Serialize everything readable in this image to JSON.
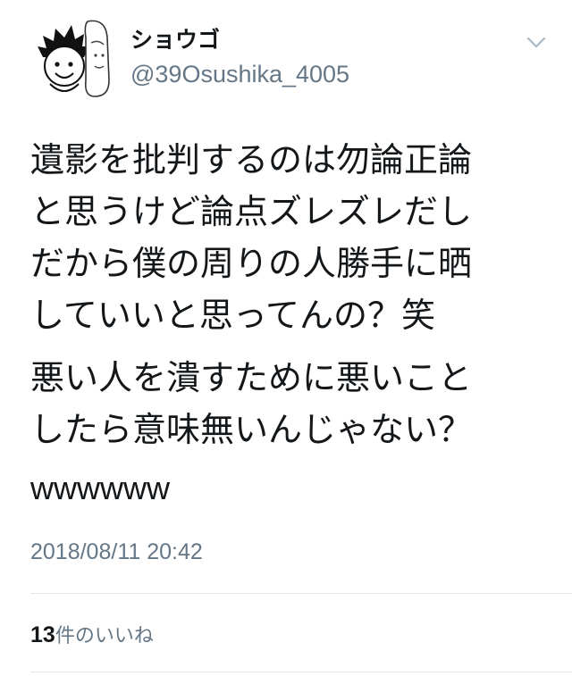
{
  "user": {
    "display_name": "ショウゴ",
    "handle": "@39Osushika_4005",
    "avatar_icon": "cartoon-avatar-icon"
  },
  "menu": {
    "icon": "chevron-down-icon"
  },
  "tweet": {
    "paragraph1": [
      "遺影を批判するのは勿論正論",
      "と思うけど論点ズレズレだし",
      "だから僕の周りの人勝手に晒",
      "していいと思ってんの？笑"
    ],
    "paragraph2": [
      "悪い人を潰すために悪いこと",
      "したら意味無いんじゃない？"
    ],
    "laugh": "wwwwww",
    "timestamp": "2018/08/11 20:42"
  },
  "likes": {
    "count": "13",
    "label": "件のいいね"
  },
  "colors": {
    "text": "#14171a",
    "secondary": "#657786",
    "divider": "#e1e8ed"
  }
}
